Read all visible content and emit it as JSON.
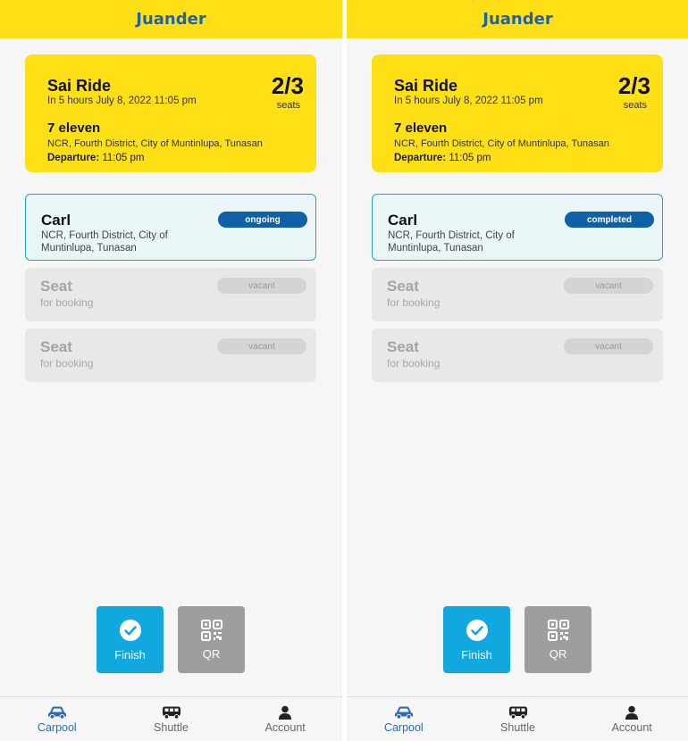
{
  "screens": [
    {
      "app_title": "Juander",
      "ride": {
        "title": "Sai Ride",
        "time": "In 5 hours July 8, 2022 11:05 pm",
        "seats_taken": "2/3",
        "seats_label": "seats",
        "stop_name": "7 eleven",
        "stop_address": "NCR, Fourth District, City of Muntinlupa, Tunasan",
        "departure_label": "Departure:",
        "departure_time": "11:05 pm"
      },
      "passenger": {
        "name": "Carl",
        "address": "NCR, Fourth District, City of Muntinlupa, Tunasan",
        "status": "ongoing"
      },
      "vacant_seats": [
        {
          "title": "Seat",
          "subtitle": "for booking",
          "status": "vacant"
        },
        {
          "title": "Seat",
          "subtitle": "for booking",
          "status": "vacant"
        }
      ],
      "actions": {
        "finish": "Finish",
        "qr": "QR"
      },
      "nav": [
        {
          "label": "Carpool"
        },
        {
          "label": "Shuttle"
        },
        {
          "label": "Account"
        }
      ]
    },
    {
      "app_title": "Juander",
      "ride": {
        "title": "Sai Ride",
        "time": "In 5 hours July 8, 2022 11:05 pm",
        "seats_taken": "2/3",
        "seats_label": "seats",
        "stop_name": "7 eleven",
        "stop_address": "NCR, Fourth District, City of Muntinlupa, Tunasan",
        "departure_label": "Departure:",
        "departure_time": "11:05 pm"
      },
      "passenger": {
        "name": "Carl",
        "address": "NCR, Fourth District, City of Muntinlupa, Tunasan",
        "status": "completed"
      },
      "vacant_seats": [
        {
          "title": "Seat",
          "subtitle": "for booking",
          "status": "vacant"
        },
        {
          "title": "Seat",
          "subtitle": "for booking",
          "status": "vacant"
        }
      ],
      "actions": {
        "finish": "Finish",
        "qr": "QR"
      },
      "nav": [
        {
          "label": "Carpool"
        },
        {
          "label": "Shuttle"
        },
        {
          "label": "Account"
        }
      ]
    }
  ],
  "colors": {
    "brand_yellow": "#ffe016",
    "title_blue": "#1e63a8",
    "badge_blue": "#0e61a6",
    "finish_blue": "#11a8e0",
    "qr_gray": "#9e9e9e",
    "active_border": "#1ba6c9"
  },
  "icons": {
    "finish": "check-circle-icon",
    "qr": "qr-code-icon",
    "carpool": "car-icon",
    "shuttle": "bus-icon",
    "account": "person-icon"
  }
}
